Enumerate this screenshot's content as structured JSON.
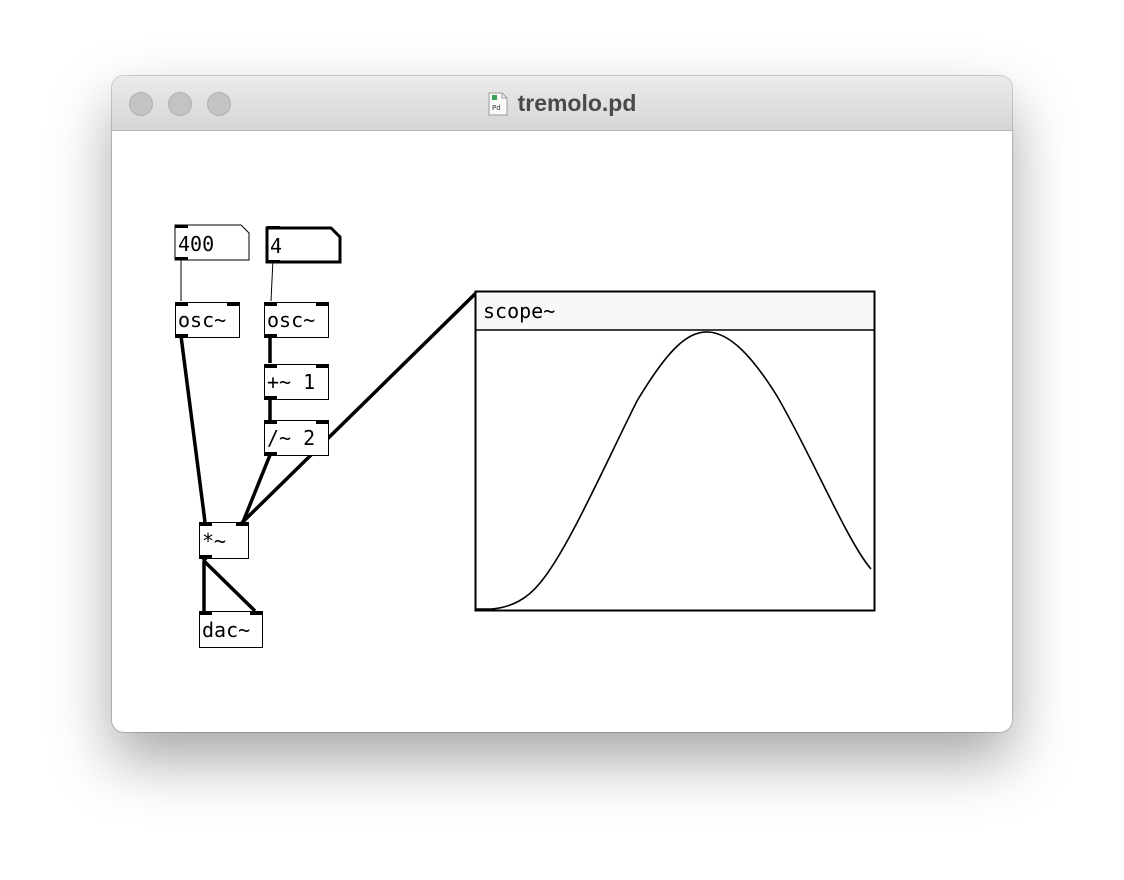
{
  "window": {
    "title": "tremolo.pd",
    "traffic_lights": [
      "close",
      "minimize",
      "zoom"
    ],
    "file_icon": "pd-document-icon"
  },
  "patch": {
    "number_boxes": [
      {
        "id": "freq",
        "value": "400"
      },
      {
        "id": "rate",
        "value": "4"
      }
    ],
    "objects": {
      "osc_carrier": "osc~",
      "osc_lfo": "osc~",
      "add": "+~ 1",
      "div": "/~ 2",
      "mul": "*~",
      "dac": "dac~"
    },
    "scope": {
      "label": "scope~",
      "waveform": "one cycle of a sine, rising from the minimum at the left, peaking near 58% of the width, then falling"
    }
  }
}
